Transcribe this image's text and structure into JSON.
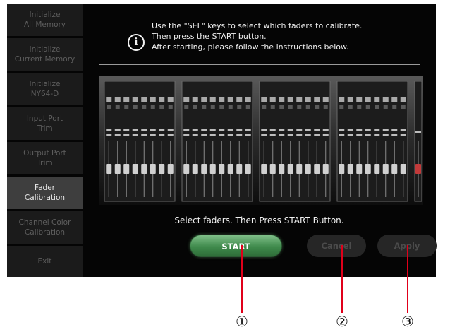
{
  "sidebar": {
    "items": [
      {
        "label": "Initialize\nAll Memory",
        "active": false
      },
      {
        "label": "Initialize\nCurrent Memory",
        "active": false
      },
      {
        "label": "Initialize\nNY64-D",
        "active": false
      },
      {
        "label": "Input Port\nTrim",
        "active": false
      },
      {
        "label": "Output Port\nTrim",
        "active": false
      },
      {
        "label": "Fader\nCalibration",
        "active": true
      },
      {
        "label": "Channel Color\nCalibration",
        "active": false
      },
      {
        "label": "Exit",
        "active": false
      }
    ]
  },
  "instructions": {
    "icon": "info-icon",
    "lines": [
      "Use the \"SEL\" keys to select which faders to calibrate.",
      "Then press the START button.",
      "After starting, please follow the instructions below."
    ]
  },
  "status_text": "Select faders. Then Press START Button.",
  "buttons": {
    "start": "START",
    "cancel": "Cancel",
    "apply": "Apply"
  },
  "callouts": [
    "①",
    "②",
    "③"
  ],
  "colors": {
    "start_green": "#3f8a4c",
    "active_item": "#3e3e3e",
    "callout_red": "#e0001a"
  }
}
